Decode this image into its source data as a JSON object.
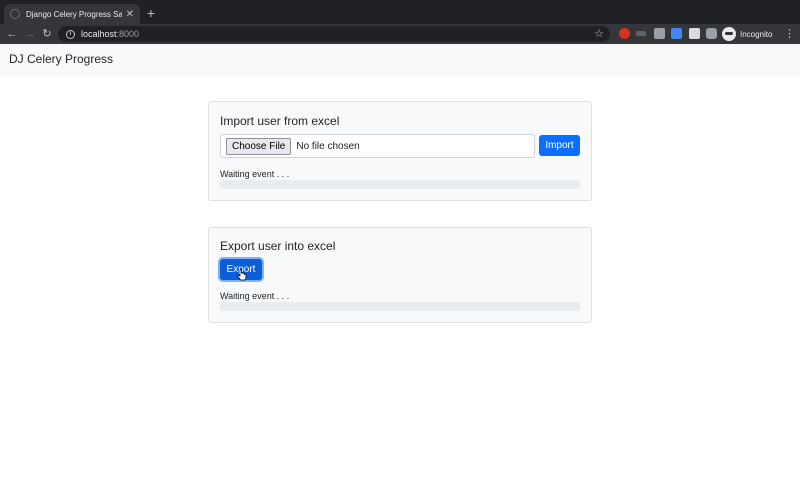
{
  "browser": {
    "tab_title": "Django Celery Progress Sample",
    "url_host": "localhost",
    "url_port": ":8000",
    "profile_label": "Incognito"
  },
  "app": {
    "brand": "DJ Celery Progress"
  },
  "import_card": {
    "title": "Import user from excel",
    "choose_file_label": "Choose File",
    "no_file_text": "No file chosen",
    "import_button": "Import",
    "status": "Waiting event . . .",
    "progress": 0
  },
  "export_card": {
    "title": "Export user into excel",
    "export_button": "Export",
    "status": "Waiting event . . .",
    "progress": 0
  },
  "colors": {
    "primary": "#0d6efd",
    "navbar_bg": "#f8f9fa",
    "chrome_dark": "#202124"
  }
}
